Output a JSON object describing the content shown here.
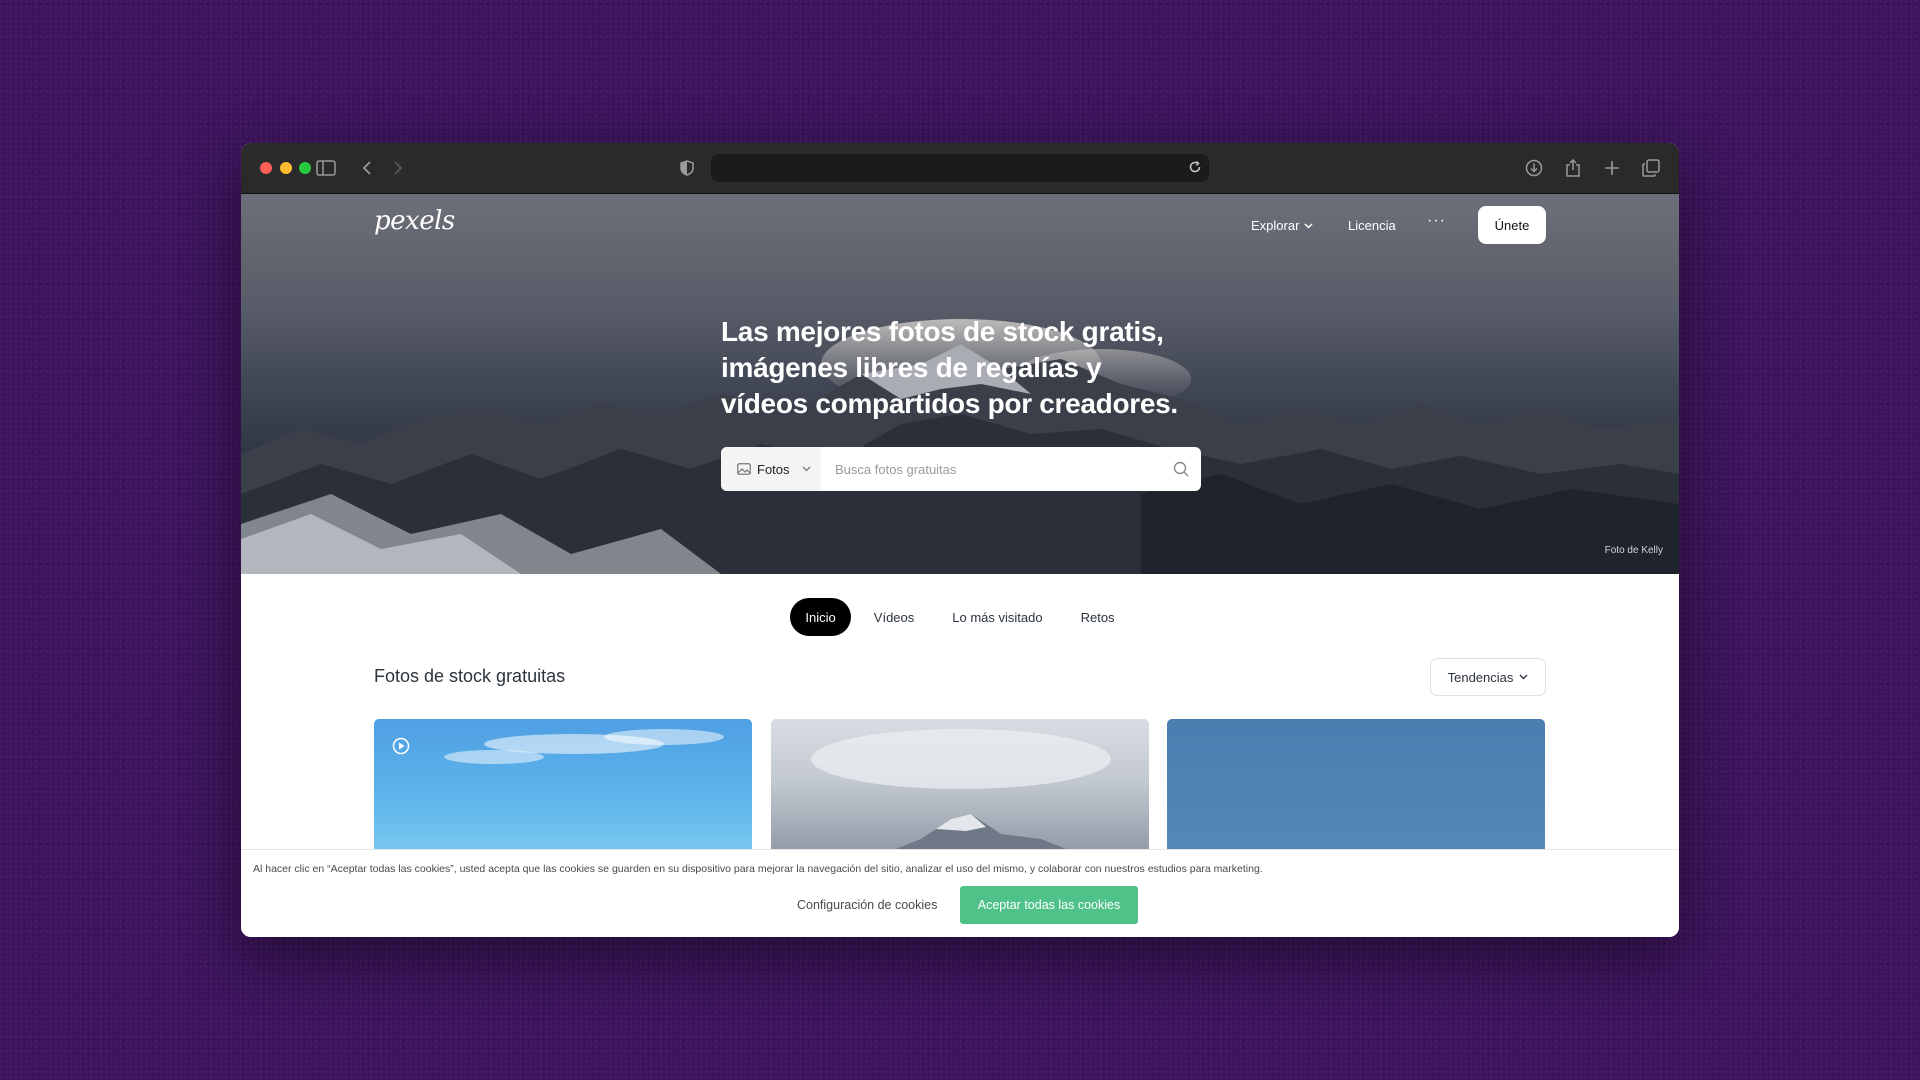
{
  "browser": {
    "icons": [
      "sidebar-icon",
      "back-icon",
      "forward-icon",
      "shield-icon",
      "reload-icon",
      "download-icon",
      "share-icon",
      "new-tab-icon",
      "tabs-overview-icon"
    ]
  },
  "header": {
    "logo": "pexels",
    "explorar": "Explorar",
    "licencia": "Licencia",
    "more": "···",
    "join": "Únete"
  },
  "hero": {
    "title": "Las mejores fotos de stock gratis, imágenes libres de regalías y vídeos compartidos por creadores.",
    "search_type": "Fotos",
    "search_placeholder": "Busca fotos gratuitas",
    "credit": "Foto de Kelly"
  },
  "tabs": [
    "Inicio",
    "Vídeos",
    "Lo más visitado",
    "Retos"
  ],
  "main": {
    "section_title": "Fotos de stock gratuitas",
    "sort_label": "Tendencias"
  },
  "cookie": {
    "text": "Al hacer clic en “Aceptar todas las cookies”, usted acepta que las cookies se guarden en su dispositivo para mejorar la navegación del sitio, analizar el uso del mismo, y colaborar con nuestros estudios para marketing.",
    "config": "Configuración de cookies",
    "accept": "Aceptar todas las cookies"
  },
  "colors": {
    "desktop": "#3d145e",
    "accept_button": "#4fc28a",
    "active_tab": "#000000"
  }
}
